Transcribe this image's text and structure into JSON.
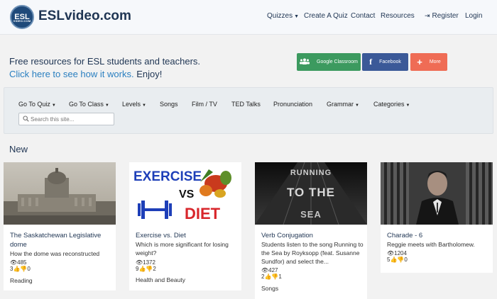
{
  "header": {
    "logo_badge": "ESL",
    "logo_badge_small": "VIDEO.COM",
    "site_name": "ESLvideo.com",
    "nav": [
      {
        "label": "Quizzes",
        "has_caret": true
      },
      {
        "label": "Create A Quiz"
      },
      {
        "label": "Contact"
      },
      {
        "label": "Resources"
      },
      {
        "label": "Register",
        "icon": "sign-in-icon"
      },
      {
        "label": "Login"
      }
    ]
  },
  "intro": {
    "line1": "Free resources for ESL students and teachers.",
    "link_text": "Click here to see how it works.",
    "suffix": " Enjoy!"
  },
  "share": [
    {
      "label": "Google Classroom",
      "icon": "google-classroom-icon",
      "color": "#3c9a5f"
    },
    {
      "label": "Facebook",
      "icon": "facebook-icon",
      "color": "#3b5998"
    },
    {
      "label": "More",
      "icon": "plus-icon",
      "color": "#ef6c55"
    }
  ],
  "filters": {
    "items": [
      {
        "label": "Go To Quiz",
        "has_caret": true
      },
      {
        "label": "Go To Class",
        "has_caret": true
      },
      {
        "label": "Levels",
        "has_caret": true
      },
      {
        "label": "Songs"
      },
      {
        "label": "Film / TV"
      },
      {
        "label": "TED Talks"
      },
      {
        "label": "Pronunciation"
      },
      {
        "label": "Grammar",
        "has_caret": true
      },
      {
        "label": "Categories",
        "has_caret": true
      }
    ],
    "search_placeholder": "Search this site..."
  },
  "section_title": "New",
  "cards": [
    {
      "title": "The Saskatchewan Legislative dome",
      "description": "How the dome was reconstructed",
      "views": "485",
      "likes": "3",
      "dislikes": "0",
      "category": "Reading"
    },
    {
      "title": "Exercise vs. Diet",
      "description": "Which is more significant for losing weight?",
      "views": "1372",
      "likes": "9",
      "dislikes": "2",
      "category": "Health and Beauty",
      "thumb_text_1": "EXERCISE",
      "thumb_text_vs": "VS",
      "thumb_text_2": "DIET"
    },
    {
      "title": "Verb Conjugation",
      "description": "Students listen to the song Running to the Sea by Royksopp (feat. Susanne Sundfor) and select the...",
      "views": "427",
      "likes": "2",
      "dislikes": "1",
      "category": "Songs",
      "thumb_text_1": "RUNNING",
      "thumb_text_2": "TO THE",
      "thumb_text_3": "SEA"
    },
    {
      "title": "Charade - 6",
      "description": "Reggie meets with Bartholomew.",
      "views": "1204",
      "likes": "5",
      "dislikes": "0",
      "category": ""
    }
  ]
}
